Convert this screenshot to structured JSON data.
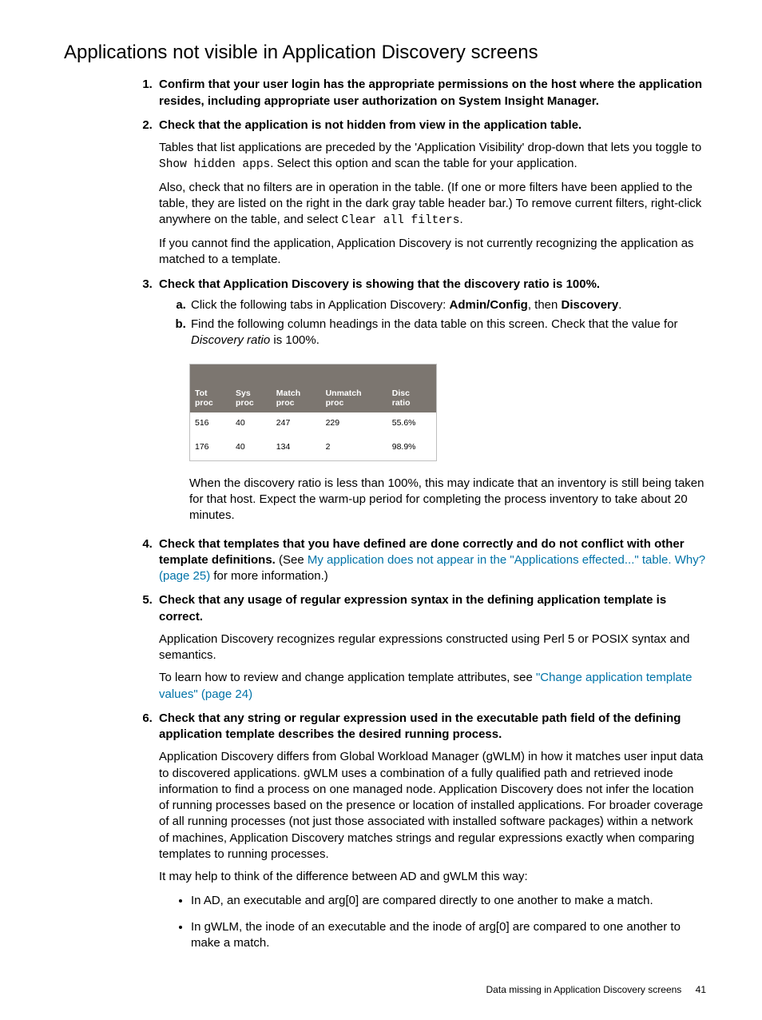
{
  "title": "Applications not visible in Application Discovery screens",
  "items": {
    "i1": {
      "head": "Confirm that your user login has the appropriate permissions on the host where the application resides, including appropriate user authorization on System Insight Manager."
    },
    "i2": {
      "head": "Check that the application is not hidden from view in the application table.",
      "p1a": "Tables that list applications are preceded by the 'Application Visibility' drop-down that lets you toggle to ",
      "code1": "Show hidden apps",
      "p1b": ". Select this option and scan the table for your application.",
      "p2a": "Also, check that no filters are in operation in the table. (If one or more filters have been applied to the table, they are listed on the right in the dark gray table header bar.) To remove current filters, right-click anywhere on the table, and select ",
      "code2": "Clear all filters",
      "p2b": ".",
      "p3": "If you cannot find the application, Application Discovery is not currently recognizing the application as matched to a template."
    },
    "i3": {
      "head": "Check that Application Discovery is showing that the discovery ratio is 100%.",
      "a_pre": "Click the following tabs in Application Discovery: ",
      "a_b1": "Admin/Config",
      "a_mid": ", then ",
      "a_b2": "Discovery",
      "a_post": ".",
      "b_pre": "Find the following column headings in the data table on this screen. Check that the value for ",
      "b_em": "Discovery ratio",
      "b_post": " is 100%.",
      "after": "When the discovery ratio is less than 100%, this may indicate that an inventory is still being taken for that host. Expect the warm-up period for completing the process inventory to take about 20 minutes."
    },
    "i4": {
      "head": "Check that templates that you have defined are done correctly and do not conflict with other template definitions.",
      "see": " (See ",
      "link": "My application does not appear in the \"Applications effected...\" table. Why? (page 25)",
      "post": " for more information.)"
    },
    "i5": {
      "head": "Check that any usage of regular expression syntax in the defining application template is correct.",
      "p1": "Application Discovery recognizes regular expressions constructed using Perl 5 or POSIX syntax and semantics.",
      "p2a": "To learn how to review and change application template attributes, see ",
      "link": "\"Change application template values\" (page 24)"
    },
    "i6": {
      "head": "Check that any string or regular expression used in the executable path field of the defining application template describes the desired running process.",
      "p1": "Application Discovery differs from Global Workload Manager (gWLM) in how it matches user input data to discovered applications. gWLM uses a combination of a fully qualified path and retrieved inode information to find a process on one managed node. Application Discovery does not infer the location of running processes based on the presence or location of installed applications. For broader coverage of all running processes (not just those associated with installed software packages) within a network of machines, Application Discovery matches strings and regular expressions exactly when comparing templates to running processes.",
      "p2": "It may help to think of the difference between AD and gWLM this way:",
      "b1": "In AD, an executable and arg[0] are compared directly to one another to make a match.",
      "b2": "In gWLM, the inode of an executable and the inode of arg[0] are compared to one another to make a match."
    }
  },
  "table": {
    "headers": [
      "Tot proc",
      "Sys proc",
      "Match proc",
      "Unmatch proc",
      "Disc ratio"
    ],
    "rows": [
      [
        "516",
        "40",
        "247",
        "229",
        "55.6%"
      ],
      [
        "176",
        "40",
        "134",
        "2",
        "98.9%"
      ]
    ]
  },
  "footer": {
    "text": "Data missing in Application Discovery screens",
    "page": "41"
  }
}
